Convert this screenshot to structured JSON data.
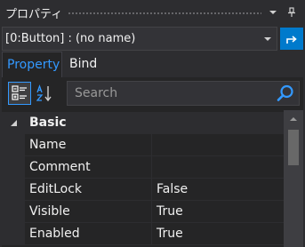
{
  "window": {
    "title": "プロパティ"
  },
  "selector": {
    "value": "[0:Button] : (no name)"
  },
  "tabs": [
    {
      "label": "Property",
      "active": true
    },
    {
      "label": "Bind",
      "active": false
    }
  ],
  "toolbar": {
    "search_placeholder": "Search"
  },
  "properties": {
    "category": "Basic",
    "rows": [
      {
        "name": "Name",
        "value": ""
      },
      {
        "name": "Comment",
        "value": ""
      },
      {
        "name": "EditLock",
        "value": "False"
      },
      {
        "name": "Visible",
        "value": "True"
      },
      {
        "name": "Enabled",
        "value": "True"
      }
    ]
  },
  "colors": {
    "background": "#2d2d30",
    "grid_background": "#252526",
    "accent": "#007acc",
    "active_tab_text": "#3399ff"
  },
  "icons": {
    "title_dropdown": "chevron-down-icon",
    "title_pin": "pin-icon",
    "selector_go": "go-to-source-icon",
    "categorized": "categorized-view-icon",
    "alphabetical": "sort-alphabetical-icon",
    "search": "search-icon"
  }
}
